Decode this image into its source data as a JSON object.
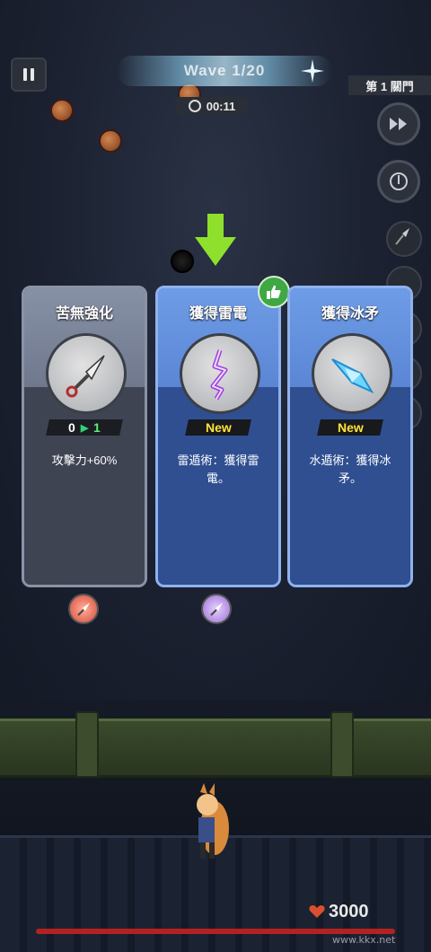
{
  "hud": {
    "wave_text": "Wave 1/20",
    "timer": "00:11",
    "stage_label": "第 1 關門",
    "gold": "3000"
  },
  "cards": [
    {
      "title": "苦無強化",
      "icon": "kunai-icon",
      "level_from": "0",
      "level_to": "1",
      "description": "攻擊力+60%"
    },
    {
      "title": "獲得雷電",
      "icon": "lightning-icon",
      "badge": "New",
      "description": "雷遁術：獲得雷電。",
      "recommended": true
    },
    {
      "title": "獲得冰矛",
      "icon": "ice-spear-icon",
      "badge": "New",
      "description": "水遁術：獲得冰矛。"
    }
  ],
  "watermark": "www.kkx.net",
  "colors": {
    "new_badge": "#ffe33a",
    "level_up": "#5cf07a",
    "recommend": "#3fa844",
    "hp": "#b32121"
  }
}
